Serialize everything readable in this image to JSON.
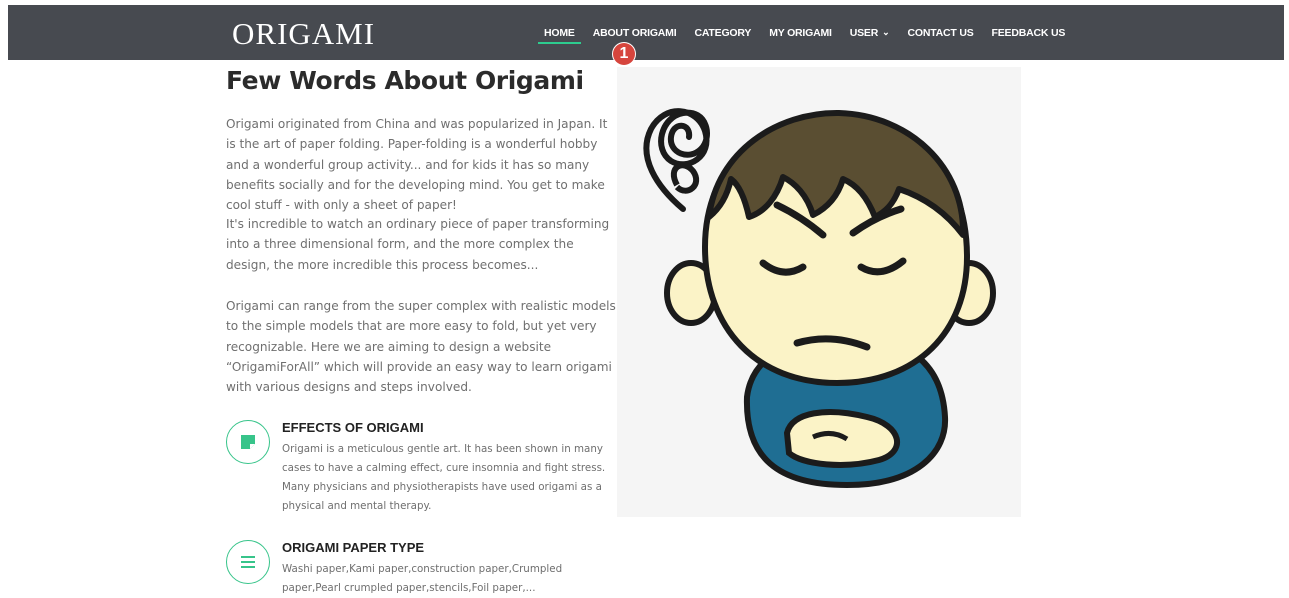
{
  "header": {
    "logo": "ORIGAMI",
    "nav": [
      {
        "label": "HOME",
        "active": true
      },
      {
        "label": "ABOUT ORIGAMI"
      },
      {
        "label": "CATEGORY"
      },
      {
        "label": "MY ORIGAMI"
      },
      {
        "label": "USER",
        "has_dropdown": true
      },
      {
        "label": "CONTACT US"
      },
      {
        "label": "FEEDBACK US"
      }
    ],
    "annotation_marker": "1"
  },
  "main": {
    "title": "Few Words About Origami",
    "paragraphs": [
      "Origami originated from China and was popularized in Japan. It is the art of paper folding. Paper-folding is a wonderful hobby and a wonderful group activity... and for kids it has so many benefits socially and for the developing mind. You get to make cool stuff - with only a sheet of paper!",
      "It's incredible to watch an ordinary piece of paper transforming into a three dimensional form, and the more complex the design, the more incredible this process becomes...",
      "Origami can range from the super complex with realistic models to the simple models that are more easy to fold, but yet very recognizable. Here we are aiming to design a website “OrigamiForAll” which will provide an easy way to learn origami with various designs and steps involved."
    ],
    "features": [
      {
        "icon": "note-icon",
        "title": "EFFECTS OF ORIGAMI",
        "text": "Origami is a meticulous gentle art. It has been shown in many cases to have a calming effect, cure insomnia and fight stress. Many physicians and physiotherapists have used origami as a physical and mental therapy."
      },
      {
        "icon": "menu-lines-icon",
        "title": "ORIGAMI PAPER TYPE",
        "text": "Washi paper,Kami paper,construction paper,Crumpled paper,Pearl crumpled paper,stencils,Foil paper,..."
      }
    ]
  },
  "colors": {
    "navbar": "#474a50",
    "accent": "#2dcc8f",
    "marker": "#d6453d",
    "hair": "#5a4e32",
    "skin": "#fbf3c7",
    "shirt": "#1f6e93"
  }
}
